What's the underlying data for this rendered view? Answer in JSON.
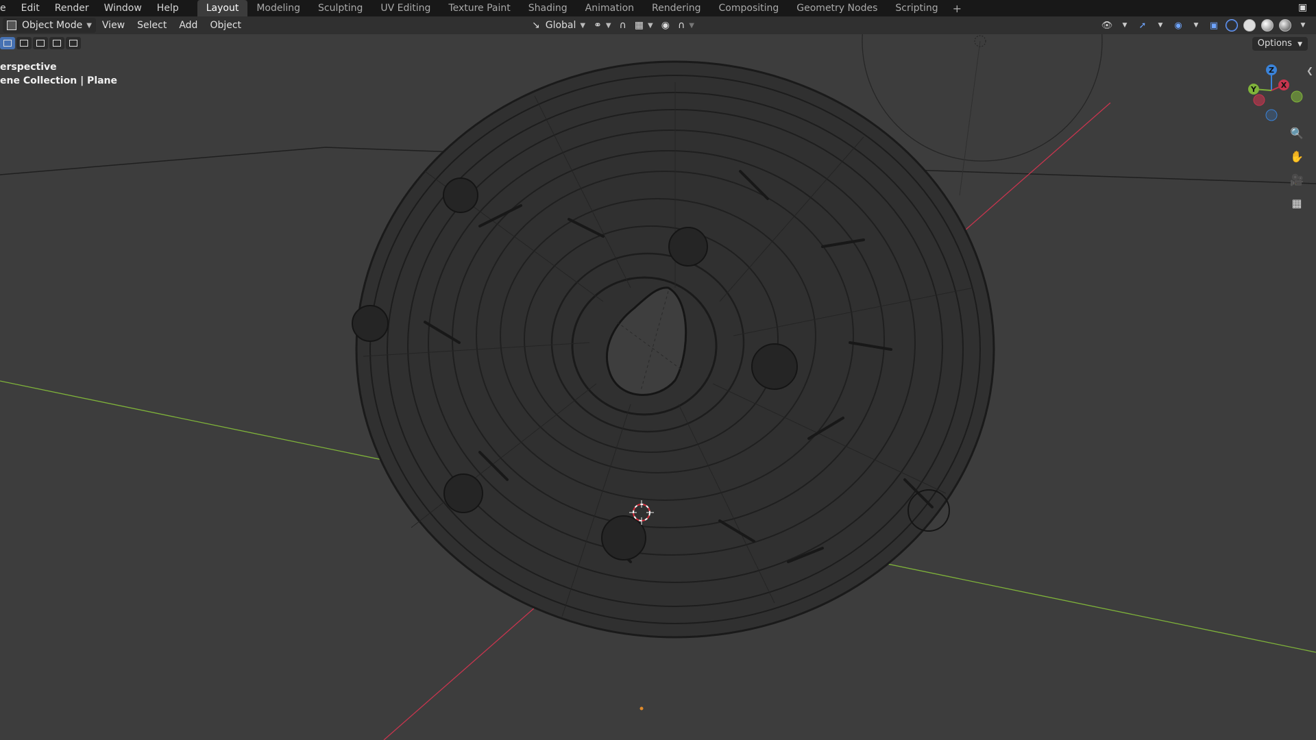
{
  "menubar": {
    "items": [
      "e",
      "Edit",
      "Render",
      "Window",
      "Help"
    ],
    "workspaces": [
      "Layout",
      "Modeling",
      "Sculpting",
      "UV Editing",
      "Texture Paint",
      "Shading",
      "Animation",
      "Rendering",
      "Compositing",
      "Geometry Nodes",
      "Scripting"
    ],
    "active_workspace": "Layout",
    "add_label": "+"
  },
  "header": {
    "mode_label": "Object Mode",
    "menus": [
      "View",
      "Select",
      "Add",
      "Object"
    ],
    "orientation_label": "Global"
  },
  "toolbar": {
    "options_label": "Options"
  },
  "overlay": {
    "view_name": "erspective",
    "collection_path": "ene Collection | Plane"
  },
  "gizmo": {
    "z_label": "Z",
    "x_label": "X",
    "y_label": "Y"
  },
  "colors": {
    "background": "#3d3d3d",
    "accent": "#4772b3",
    "x_axis": "#c8354e",
    "y_axis": "#7fb33a",
    "z_axis": "#3a83d9"
  },
  "icons": [
    "search-zoom-icon",
    "hand-pan-icon",
    "camera-icon",
    "grid-perspective-icon"
  ]
}
